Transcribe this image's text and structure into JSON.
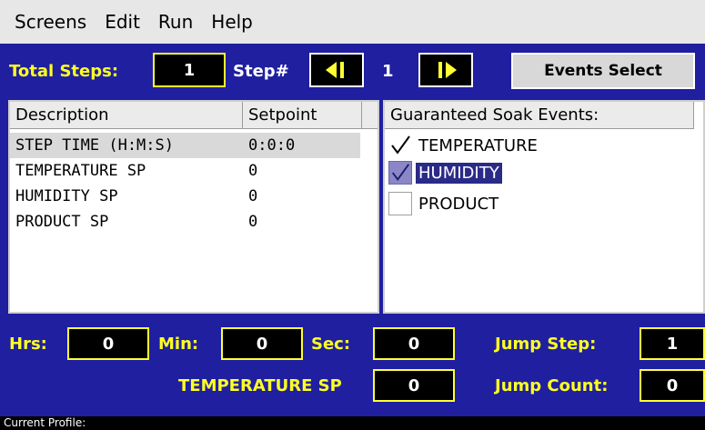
{
  "menu": [
    "Screens",
    "Edit",
    "Run",
    "Help"
  ],
  "toolbar": {
    "total_steps_label": "Total Steps:",
    "total_steps_value": "1",
    "step_label": "Step#",
    "step_value": "1",
    "events_button": "Events Select"
  },
  "steps_table": {
    "headers": [
      "Description",
      "Setpoint"
    ],
    "rows": [
      {
        "description": "STEP TIME (H:M:S)",
        "setpoint": "0:0:0",
        "selected": true
      },
      {
        "description": "TEMPERATURE SP",
        "setpoint": "0"
      },
      {
        "description": "HUMIDITY SP",
        "setpoint": "0"
      },
      {
        "description": "PRODUCT SP",
        "setpoint": "0"
      }
    ]
  },
  "soak_events": {
    "header": "Guaranteed Soak Events:",
    "items": [
      {
        "label": "TEMPERATURE",
        "checked": true
      },
      {
        "label": "HUMIDITY",
        "checked": true,
        "selected": true
      },
      {
        "label": "PRODUCT",
        "checked": false
      }
    ]
  },
  "time_fields": {
    "hrs_label": "Hrs:",
    "hrs_value": "0",
    "min_label": "Min:",
    "min_value": "0",
    "sec_label": "Sec:",
    "sec_value": "0"
  },
  "jump": {
    "step_label": "Jump Step:",
    "step_value": "1",
    "count_label": "Jump Count:",
    "count_value": "0"
  },
  "current_sp": {
    "label": "TEMPERATURE SP",
    "value": "0"
  },
  "status": {
    "text": "Current Profile:"
  },
  "colors": {
    "background": "#1f1fa0",
    "label_yellow": "#ffff22",
    "box_border": "#ffff33"
  }
}
